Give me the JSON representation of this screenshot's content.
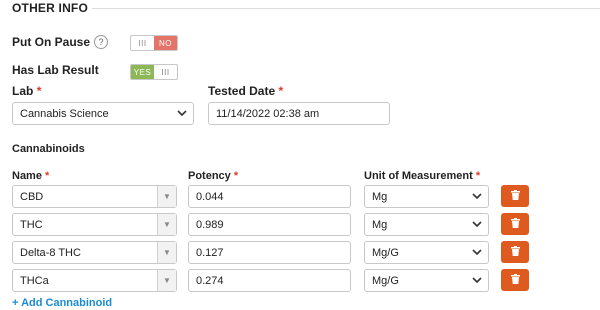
{
  "section": {
    "title": "OTHER INFO"
  },
  "put_on_pause": {
    "label": "Put On Pause",
    "help": "?",
    "off_text": "III",
    "state_text": "NO"
  },
  "has_lab_result": {
    "label": "Has Lab Result",
    "state_text": "YES",
    "off_text": "III"
  },
  "lab": {
    "label": "Lab",
    "required": "*",
    "value": "Cannabis Science"
  },
  "tested_date": {
    "label": "Tested Date",
    "required": "*",
    "value": "11/14/2022 02:38 am"
  },
  "cannabinoids": {
    "heading": "Cannabinoids",
    "headers": {
      "name": "Name",
      "potency": "Potency",
      "unit": "Unit of Measurement",
      "required": "*"
    },
    "rows": [
      {
        "name": "CBD",
        "potency": "0.044",
        "unit": "Mg"
      },
      {
        "name": "THC",
        "potency": "0.989",
        "unit": "Mg"
      },
      {
        "name": "Delta-8 THC",
        "potency": "0.127",
        "unit": "Mg/G"
      },
      {
        "name": "THCa",
        "potency": "0.274",
        "unit": "Mg/G"
      }
    ],
    "add_link": "+ Add Cannabinoid"
  },
  "colors": {
    "danger": "#de5a1e",
    "link": "#1a8bd1",
    "toggle_no": "#e4736a",
    "toggle_yes": "#8db858"
  }
}
